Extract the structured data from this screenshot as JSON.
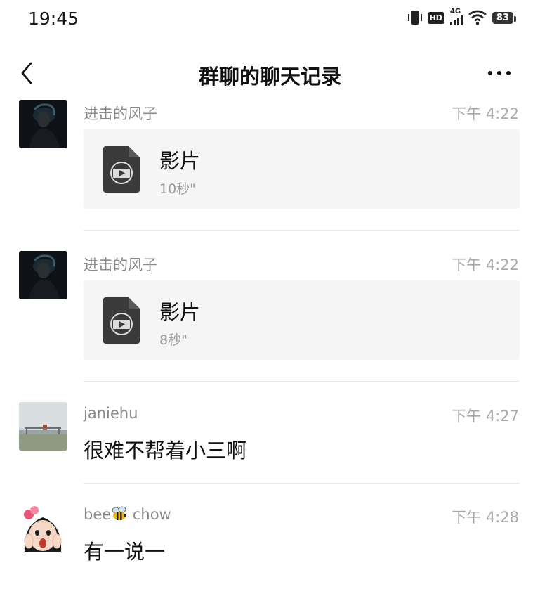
{
  "status_bar": {
    "time": "19:45",
    "hd_label": "HD",
    "network_label": "4G",
    "battery": "83"
  },
  "nav": {
    "title": "群聊的聊天记录"
  },
  "messages": [
    {
      "sender": "进击的风子",
      "time": "下午 4:22",
      "type": "video",
      "file_name": "影片",
      "duration": "10秒\""
    },
    {
      "sender": "进击的风子",
      "time": "下午 4:22",
      "type": "video",
      "file_name": "影片",
      "duration": "8秒\""
    },
    {
      "sender": "janiehu",
      "time": "下午 4:27",
      "type": "text",
      "text": "很难不帮着小三啊"
    },
    {
      "sender_prefix": "bee",
      "sender_suffix": " chow",
      "sender_emoji_icon": "bee-icon",
      "time": "下午 4:28",
      "type": "text",
      "text": "有一说一"
    }
  ]
}
